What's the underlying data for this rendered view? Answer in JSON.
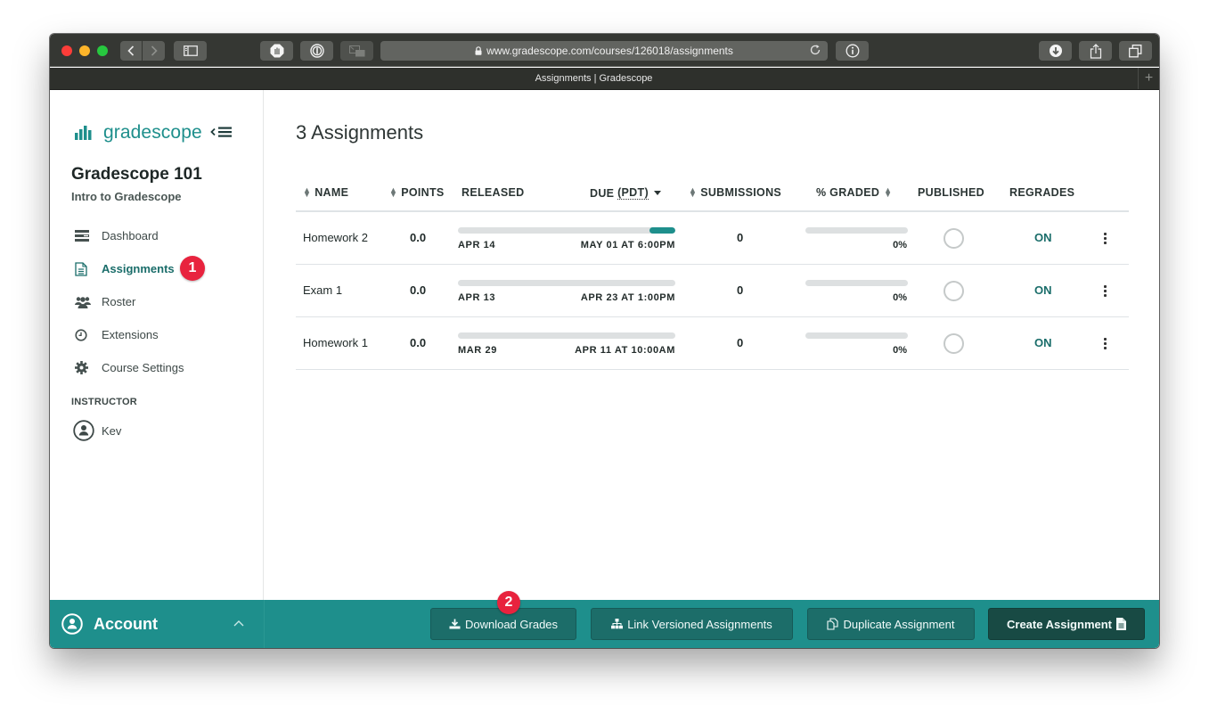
{
  "browser": {
    "url": "www.gradescope.com/courses/126018/assignments",
    "tab_title": "Assignments | Gradescope",
    "new_tab_label": "+"
  },
  "sidebar": {
    "brand": "gradescope",
    "course_title": "Gradescope 101",
    "course_subtitle": "Intro to Gradescope",
    "items": [
      {
        "label": "Dashboard",
        "icon": "dashboard-icon",
        "active": false
      },
      {
        "label": "Assignments",
        "icon": "document-icon",
        "active": true
      },
      {
        "label": "Roster",
        "icon": "users-icon",
        "active": false
      },
      {
        "label": "Extensions",
        "icon": "clock-icon",
        "active": false
      },
      {
        "label": "Course Settings",
        "icon": "gear-icon",
        "active": false
      }
    ],
    "section_label": "INSTRUCTOR",
    "user_name": "Kev",
    "account_label": "Account"
  },
  "annotations": {
    "badge_1": "1",
    "badge_2": "2"
  },
  "main": {
    "title": "3 Assignments",
    "columns": {
      "name": "NAME",
      "points": "POINTS",
      "released": "RELEASED",
      "due": "DUE",
      "due_tz": "(PDT)",
      "submissions": "SUBMISSIONS",
      "graded": "% GRADED",
      "published": "PUBLISHED",
      "regrades": "REGRADES"
    },
    "rows": [
      {
        "name": "Homework 2",
        "points": "0.0",
        "released": "APR 14",
        "due": "MAY 01 AT 6:00PM",
        "time_progress": 0.12,
        "submissions": "0",
        "graded_pct": "0%",
        "graded_fraction": 0,
        "published": false,
        "regrades": "ON"
      },
      {
        "name": "Exam 1",
        "points": "0.0",
        "released": "APR 13",
        "due": "APR 23 AT 1:00PM",
        "time_progress": 0,
        "submissions": "0",
        "graded_pct": "0%",
        "graded_fraction": 0,
        "published": false,
        "regrades": "ON"
      },
      {
        "name": "Homework 1",
        "points": "0.0",
        "released": "MAR 29",
        "due": "APR 11 AT 10:00AM",
        "time_progress": 0,
        "submissions": "0",
        "graded_pct": "0%",
        "graded_fraction": 0,
        "published": false,
        "regrades": "ON"
      }
    ]
  },
  "footer": {
    "download_grades": "Download Grades",
    "link_versioned": "Link Versioned Assignments",
    "duplicate": "Duplicate Assignment",
    "create": "Create Assignment"
  },
  "colors": {
    "brand": "#1e8f8c",
    "active_nav": "#1a6d6a",
    "badge": "#e8233e",
    "footer_bg": "#1e8f8c",
    "primary_button": "#184a44"
  }
}
